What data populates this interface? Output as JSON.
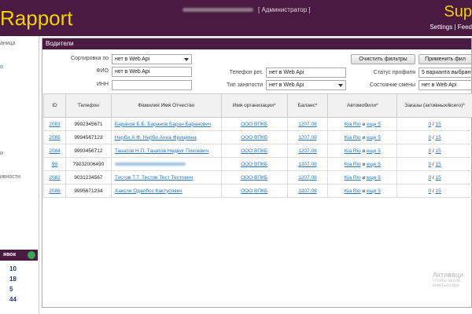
{
  "header": {
    "brand": "Rapport",
    "brand_right": "Sup",
    "user_role": "[ Администратор ]",
    "links": "Settings | Feed"
  },
  "sidebar": {
    "item_main": "аница",
    "item_blue": "о",
    "item_1": "и",
    "item_2": "ивности"
  },
  "stats": {
    "title": "явок",
    "values": [
      "10",
      "18",
      "5",
      "44"
    ]
  },
  "panel": {
    "title": "Водители"
  },
  "filters": {
    "sort_label": "Сортировка по",
    "sort_value": "нет в Web Api",
    "fio_label": "ФИО",
    "fio_value": "нет в Web Api",
    "inn_label": "ИНН",
    "inn_value": "",
    "phone_label": "Телефон рег.",
    "phone_value": "нет в Web Api",
    "employment_label": "Тип занятости",
    "employment_value": "нет в Web Api",
    "profile_label": "Статус профиля",
    "profile_value": "5 варианта выбран",
    "shift_label": "Состояние смены",
    "shift_value": "нет в Web Api",
    "clear_button": "Очистить фильтры",
    "apply_button": "Применить фил"
  },
  "table": {
    "headers": [
      "ID",
      "Телефон",
      "Фамилия Имя Отчество",
      "Имя организации*",
      "Баланс*",
      "Автомобили*",
      "Заказы (активных/всего)*"
    ],
    "rows": [
      {
        "id": "2083",
        "phone": "9992345671",
        "name": "Баранов Б.Б. Баранов Баран Баранович",
        "org": "ООО ВПКБ",
        "balance": "1207.08",
        "car": "Kia Rio",
        "and": "и",
        "more": "еще 5",
        "active": "0",
        "slash": "/",
        "total": "15"
      },
      {
        "id": "2085",
        "phone": "9994567123",
        "name": "Нерби А.Ф. Нерби Анна Фрицевна",
        "org": "ООО ВПКБ",
        "balance": "1207.08",
        "car": "Kia Rio",
        "and": "и",
        "more": "еще 5",
        "active": "0",
        "slash": "/",
        "total": "15"
      },
      {
        "id": "2084",
        "phone": "9993456712",
        "name": "Танатов Н.П. Танатов Недвиг Покоевич",
        "org": "ООО ВПКБ",
        "balance": "1207.08",
        "car": "Kia Rio",
        "and": "и",
        "more": "еще 5",
        "active": "0",
        "slash": "/",
        "total": "15"
      },
      {
        "id": "99",
        "phone": "79032006490",
        "name": "",
        "org": "ООО ВПКБ",
        "balance": "1207.08",
        "car": "Kia Rio",
        "and": "и",
        "more": "еще 5",
        "active": "0",
        "slash": "/",
        "total": "15"
      },
      {
        "id": "2082",
        "phone": "9031234567",
        "name": "Тестов Т.Т. Тестов Тест Тестович",
        "org": "ООО ВПКБ",
        "balance": "1207.08",
        "car": "Kia Rio",
        "and": "и",
        "more": "еще 5",
        "active": "0",
        "slash": "/",
        "total": "15"
      },
      {
        "id": "2086",
        "phone": "9995671234",
        "name": "Хаксли Одалбос Кактусович",
        "org": "ООО ВПКБ",
        "balance": "1207.08",
        "car": "Kia Rio",
        "and": "и",
        "more": "еще 5",
        "active": "0",
        "slash": "/",
        "total": "15"
      }
    ]
  },
  "watermark": {
    "title": "Активаци",
    "line1": "Чтобы актив",
    "line2": "компьютера"
  },
  "colors": {
    "header_bg": "#4a1a42",
    "brand": "#f2d300",
    "link": "#2a78c5"
  }
}
